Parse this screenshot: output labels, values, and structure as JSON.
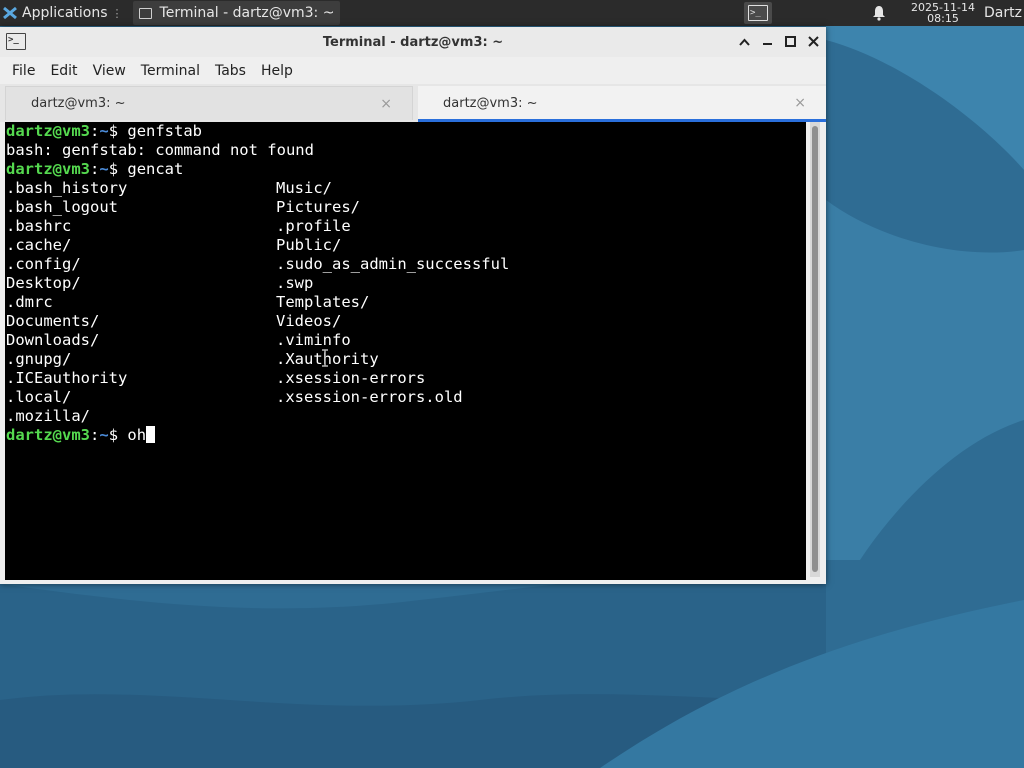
{
  "panel": {
    "applications_label": "Applications",
    "task_label": "Terminal - dartz@vm3: ~",
    "date": "2025-11-14",
    "time": "08:15",
    "user": "Dartz"
  },
  "window": {
    "title": "Terminal - dartz@vm3: ~",
    "menu": [
      "File",
      "Edit",
      "View",
      "Terminal",
      "Tabs",
      "Help"
    ],
    "tabs": [
      {
        "label": "dartz@vm3: ~",
        "close": "×"
      },
      {
        "label": "dartz@vm3: ~",
        "close": "×"
      }
    ]
  },
  "terminal": {
    "prompt_user": "dartz@vm3",
    "prompt_sep": ":",
    "prompt_path": "~",
    "prompt_symbol": "$ ",
    "commands": [
      "genfstab",
      "gencat",
      "oh"
    ],
    "error_line": "bash: genfstab: command not found",
    "listing": [
      [
        ".bash_history",
        "Music/"
      ],
      [
        ".bash_logout",
        "Pictures/"
      ],
      [
        ".bashrc",
        ".profile"
      ],
      [
        ".cache/",
        "Public/"
      ],
      [
        ".config/",
        ".sudo_as_admin_successful"
      ],
      [
        "Desktop/",
        ".swp"
      ],
      [
        ".dmrc",
        "Templates/"
      ],
      [
        "Documents/",
        "Videos/"
      ],
      [
        "Downloads/",
        ".viminfo"
      ],
      [
        ".gnupg/",
        ".Xauthority"
      ],
      [
        ".ICEauthority",
        ".xsession-errors"
      ],
      [
        ".local/",
        ".xsession-errors.old"
      ],
      [
        ".mozilla/",
        ""
      ]
    ]
  },
  "colors": {
    "prompt_user": "#55d94f",
    "prompt_path": "#4b8bd8",
    "tab_active_accent": "#2a6fdb",
    "desktop": "#2f6c93"
  },
  "icons": {
    "apps": "xfce-logo-icon",
    "task": "terminal-icon",
    "launcher": "terminal-launcher-icon",
    "notifications": "bell-icon"
  }
}
